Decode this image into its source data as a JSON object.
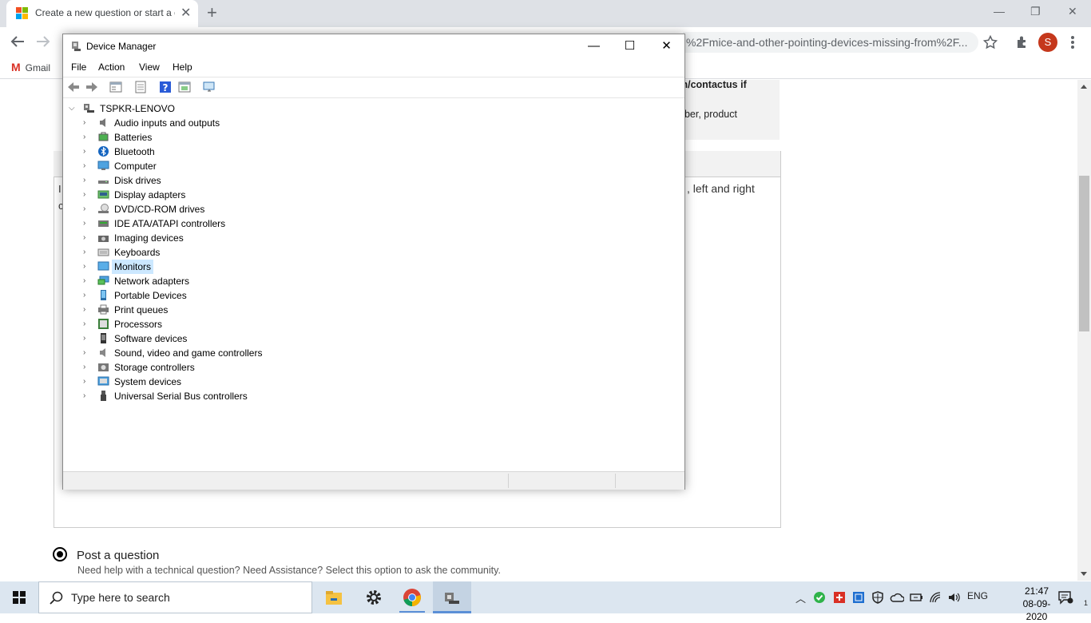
{
  "browser": {
    "tab_title": "Create a new question or start a discussion",
    "new_tab_glyph": "+",
    "close_tab_glyph": "✕",
    "url_fragment": "%2Fmice-and-other-pointing-devices-missing-from%2F...",
    "bookmark": "Gmail",
    "avatar_letter": "S",
    "window_controls": {
      "minimize": "—",
      "restore": "❐",
      "close": "✕"
    }
  },
  "page": {
    "notice_line1": "m/contactus if",
    "notice_line2": "nber, product",
    "left_text_1": "I",
    "left_text_2": "c",
    "right_text": ", left and right",
    "post_question_label": "Post a question",
    "post_question_help": "Need help with a technical question? Need Assistance? Select this option to ask the community."
  },
  "device_manager": {
    "title": "Device Manager",
    "caption": {
      "minimize": "—",
      "maximize": "☐",
      "close": "✕"
    },
    "menu": [
      "File",
      "Action",
      "View",
      "Help"
    ],
    "root": "TSPKR-LENOVO",
    "categories": [
      {
        "label": "Audio inputs and outputs",
        "icon": "speaker-icon"
      },
      {
        "label": "Batteries",
        "icon": "battery-icon"
      },
      {
        "label": "Bluetooth",
        "icon": "bluetooth-icon"
      },
      {
        "label": "Computer",
        "icon": "computer-icon"
      },
      {
        "label": "Disk drives",
        "icon": "disk-drive-icon"
      },
      {
        "label": "Display adapters",
        "icon": "display-adapter-icon"
      },
      {
        "label": "DVD/CD-ROM drives",
        "icon": "dvd-drive-icon"
      },
      {
        "label": "IDE ATA/ATAPI controllers",
        "icon": "ide-controller-icon"
      },
      {
        "label": "Imaging devices",
        "icon": "camera-icon"
      },
      {
        "label": "Keyboards",
        "icon": "keyboard-icon"
      },
      {
        "label": "Monitors",
        "icon": "monitor-icon",
        "selected": true
      },
      {
        "label": "Network adapters",
        "icon": "network-adapter-icon"
      },
      {
        "label": "Portable Devices",
        "icon": "portable-device-icon"
      },
      {
        "label": "Print queues",
        "icon": "printer-icon"
      },
      {
        "label": "Processors",
        "icon": "processor-icon"
      },
      {
        "label": "Software devices",
        "icon": "software-device-icon"
      },
      {
        "label": "Sound, video and game controllers",
        "icon": "sound-controller-icon"
      },
      {
        "label": "Storage controllers",
        "icon": "storage-controller-icon"
      },
      {
        "label": "System devices",
        "icon": "system-device-icon"
      },
      {
        "label": "Universal Serial Bus controllers",
        "icon": "usb-icon"
      }
    ]
  },
  "taskbar": {
    "search_placeholder": "Type here to search",
    "language": "ENG",
    "time": "21:47",
    "date": "08-09-2020"
  }
}
